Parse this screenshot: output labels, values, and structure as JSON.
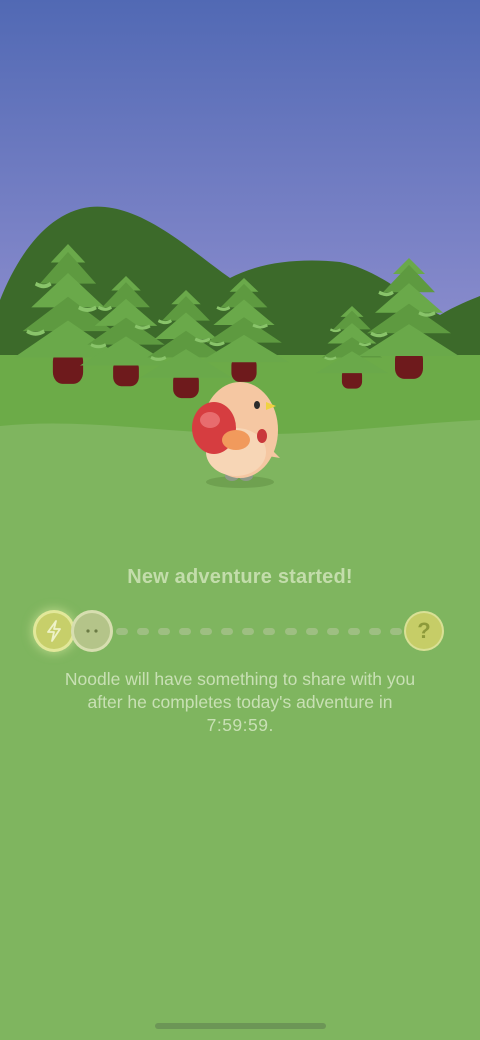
{
  "adventure": {
    "title": "New adventure started!",
    "message_line1": "Noodle will have something to share with you",
    "message_line2": "after he completes today's adventure in",
    "timer": "7:59:59",
    "timer_suffix": ".",
    "mystery_symbol": "?"
  },
  "progress": {
    "steps_total": 16,
    "current_step": 1
  },
  "icons": {
    "energy": "lightning-bolt-icon",
    "companion": "face-icon",
    "reward": "question-mark-icon"
  },
  "colors": {
    "sky_top": "#5169b4",
    "sky_bottom": "#8f8fcf",
    "grass": "#7fb55f",
    "title_text": "#c3ddab"
  }
}
